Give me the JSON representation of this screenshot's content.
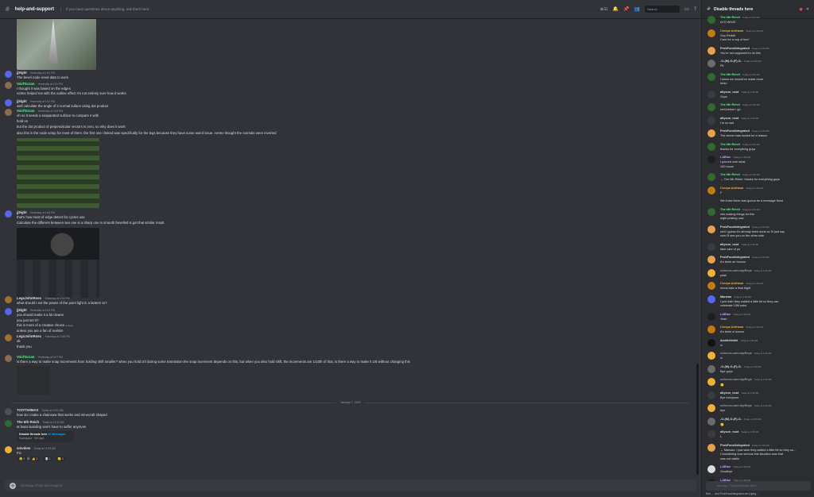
{
  "header": {
    "hash": "#",
    "channel": "help-and-support",
    "topic": "If you have questions about anything, ask them here.",
    "search_placeholder": "Search",
    "thread_count": "31"
  },
  "messages": [
    {
      "user": "jj9ight",
      "time": "Yesterday at 1:51 PM",
      "color": "#dbdee1",
      "av": "#5865f2",
      "lines": [
        "The bevel node need data to work"
      ]
    },
    {
      "user": "VoidTarzan",
      "time": "Yesterday at 1:51 PM",
      "color": "#57f287",
      "av": "#8a6d4e",
      "lines": [
        "I thought it was based on the edges"
      ]
    },
    {
      "user": "",
      "time": "",
      "lines": [
        "vortex helped me with the outline effect i'm not entirely sure how it works"
      ]
    },
    {
      "user": "jj9ight",
      "time": "Yesterday at 1:52 PM",
      "color": "#dbdee1",
      "av": "#5865f2",
      "lines": [
        "well calculate the angle of 2 normal suface using dot product"
      ]
    },
    {
      "user": "VoidTarzan",
      "time": "Yesterday at 1:53 PM",
      "color": "#57f287",
      "av": "#8a6d4e",
      "lines": [
        "oh so it needs a seaparated surface to compare it with"
      ]
    },
    {
      "user": "",
      "time": "",
      "lines": [
        "hold on"
      ]
    },
    {
      "user": "",
      "time": "",
      "lines": [
        "but the dot product of perpendicular vectors is zero, so why does it work"
      ]
    },
    {
      "user": "",
      "time": "",
      "lines": [
        "also this is the node setup for most of them. the first one i linked was specifically for the legs because they have some weird issue. vortex thought the normals were inverted"
      ]
    },
    {
      "user": "jj9ight",
      "time": "Yesterday at 1:54 PM",
      "color": "#dbdee1",
      "av": "#5865f2",
      "lines": [
        "that's how most of edge detect for cycles use",
        "Calculate the different between two one is a sharp one is smooth bevelled is get that similar result"
      ]
    },
    {
      "user": "LegoJohnRoes",
      "time": "Yesterday at 2:02 PM",
      "color": "#dbdee1",
      "av": "#a0712d",
      "lines": [
        "what should I set the power of the point light in a lantern to?"
      ]
    },
    {
      "user": "jj9ight",
      "time": "Yesterday at 2:04 PM",
      "color": "#dbdee1",
      "av": "#5865f2",
      "lines": [
        "you should make it a bit clearer",
        "you just set it?",
        "this is more of a creative choice",
        "unless you are a fan of realism"
      ]
    },
    {
      "user": "LegoJohnRoes",
      "time": "Yesterday at 2:05 PM",
      "color": "#dbdee1",
      "av": "#a0712d",
      "lines": [
        "ok",
        "thank you"
      ]
    },
    {
      "user": "VoidTarzan",
      "time": "Yesterday at 3:07 PM",
      "color": "#57f287",
      "av": "#8a6d4e",
      "lines": [
        "is there a way to make snap increments from holding shift smaller? when you hold ctrl during some translation the snap increment depends on this, but when you also hold shift, the increments are 1/10th of that, is there a way to make it 1/8 without changing this"
      ]
    },
    {
      "user": "TOOTSHMAX",
      "time": "Today at 12:31 AM",
      "color": "#dbdee1",
      "av": "#4e5058",
      "lines": [
        "how do i make a chainsaw that works and minecraft shaped"
      ]
    },
    {
      "user": "The 6th Reich",
      "time": "Today at 12:32 AM",
      "color": "#dbdee1",
      "av": "#2f6b2f",
      "lines": [
        "at least standing won't have to suffer anymore"
      ]
    },
    {
      "user": "smvdem",
      "time": "Today at 12:33 AM",
      "color": "#dbdee1",
      "av": "#f0b232",
      "lines": [
        "Fix",
        "All the channels"
      ]
    }
  ],
  "divider_date": "January 7, 2023",
  "edited": "(edited)",
  "thread_embed": {
    "title": "Disable threads here",
    "mention": "10 Messages",
    "preview": "Ryangoyo · 5m ago"
  },
  "reactions": [
    "2",
    "1",
    "1",
    "1"
  ],
  "composer_placeholder": "Message #help-and-support",
  "thread_panel": {
    "title": "Disable threads here",
    "items": [
      {
        "user": "The 6th Reich",
        "time": "Today at 1:00 AM",
        "color": "#57f287",
        "av": "#2f6b2f",
        "lines": [
          "AYO WHAT"
        ]
      },
      {
        "user": "Creeps Ardhana",
        "time": "Today at 1:05 AM",
        "color": "#f0b232",
        "av": "#c27c0e",
        "lines": [
          "Guy Reddit",
          "Care for a cup of tea?"
        ]
      },
      {
        "user": "ProbFocalIntegrated",
        "time": "Today at 1:06 AM",
        "color": "#dbdee1",
        "av": "#e8a04c",
        "lines": [
          "You're not supposed to do this"
        ]
      },
      {
        "user": "-O-(M)-O-(F)-O-",
        "time": "Today at 1:06 AM",
        "color": "#dbdee1",
        "av": "#6b6b6b",
        "lines": [
          "Pit"
        ]
      },
      {
        "user": "The 6th Reich",
        "time": "Today at 1:06 AM",
        "color": "#57f287",
        "av": "#2f6b2f",
        "lines": [
          "I knew we should've made more",
          "Imao"
        ]
      },
      {
        "user": "allyson_noot",
        "time": "Today at 1:06 AM",
        "color": "#dbdee1",
        "av": "#3a3b40",
        "lines": [
          "Guys"
        ]
      },
      {
        "user": "The 6th Reich",
        "time": "Today at 1:06 AM",
        "color": "#57f287",
        "av": "#2f6b2f",
        "lines": [
          "well,before i go"
        ]
      },
      {
        "user": "allyson_noot",
        "time": "Today at 1:06 AM",
        "color": "#dbdee1",
        "av": "#3a3b40",
        "lines": [
          "I'm so sad"
        ]
      },
      {
        "user": "ProbFocalIntegrated",
        "time": "Today at 1:06 AM",
        "color": "#dbdee1",
        "av": "#e8a04c",
        "lines": [
          "The server was locked for a reason"
        ]
      },
      {
        "user": "The 6th Reich",
        "time": "Today at 1:06 AM",
        "color": "#57f287",
        "av": "#2f6b2f",
        "lines": [
          "thanks for everything guys"
        ]
      },
      {
        "user": "LABlue",
        "time": "Today at 1:06 AM",
        "color": "#c9a0ff",
        "av": "#1e1f22",
        "lines": [
          "I poured over what",
          "100 hours"
        ]
      },
      {
        "user": "The 6th Reich",
        "time": "Today at 1:06 AM",
        "color": "#57f287",
        "av": "#2f6b2f",
        "lines": [
          "→ The 6th Reich: thanks for everything guys"
        ]
      },
      {
        "user": "Creeps Ardhana",
        "time": "Today at 1:06 AM",
        "color": "#f0b232",
        "av": "#c27c0e",
        "lines": [
          "F"
        ]
      },
      {
        "user": "",
        "time": "",
        "lines": [
          "We knew there was gonna be a message flood"
        ]
      },
      {
        "user": "The 6th Reich",
        "time": "Today at 1:06 AM",
        "color": "#57f287",
        "av": "#2f6b2f",
        "lines": [
          "into making things for this",
          "eight posting now"
        ]
      },
      {
        "user": "ProbFocalIntegrated",
        "time": "Today at 1:06 AM",
        "color": "#dbdee1",
        "av": "#e8a04c",
        "lines": [
          "well i guess it's already been done so i'll just say",
          "now i'll see you on the other side"
        ]
      },
      {
        "user": "allyson_noot",
        "time": "Today at 1:06 AM",
        "color": "#dbdee1",
        "av": "#3a3b40",
        "lines": [
          "take care of ya"
        ]
      },
      {
        "user": "ProbFocalIntegrated",
        "time": "Today at 1:06 AM",
        "color": "#dbdee1",
        "av": "#e8a04c",
        "lines": [
          "It's been an honour"
        ]
      },
      {
        "user": "oohcrus.sam.topReya",
        "time": "Today at 1:06 AM",
        "color": "#949ba4",
        "av": "#f0b232",
        "lines": [
          "yeah"
        ]
      },
      {
        "user": "Creeps Ardhana",
        "time": "Today at 1:06 AM",
        "color": "#f0b232",
        "av": "#c27c0e",
        "lines": [
          "Imma take a final flight"
        ]
      },
      {
        "user": "Marwan",
        "time": "Today at 1:06 AM",
        "color": "#dbdee1",
        "av": "#5865f2",
        "lines": [
          "I just wish they waited a little bit so they can",
          "celebrate 10M subs"
        ]
      },
      {
        "user": "LABlue",
        "time": "Today at 1:06 AM",
        "color": "#c9a0ff",
        "av": "#1e1f22",
        "lines": [
          "Yeah"
        ]
      },
      {
        "user": "Creeps Ardhana",
        "time": "Today at 1:06 AM",
        "color": "#f0b232",
        "av": "#c27c0e",
        "lines": [
          "It's been a honour"
        ]
      },
      {
        "user": "doublelinkhi",
        "time": "Today at 1:06 AM",
        "color": "#dbdee1",
        "av": "#111214",
        "lines": [
          "o/"
        ]
      },
      {
        "user": "oohcrus.sam.topReya",
        "time": "Today at 1:06 AM",
        "color": "#949ba4",
        "av": "#f0b232",
        "lines": [
          "o/"
        ]
      },
      {
        "user": "-O-(M)-O-(F)-O-",
        "time": "Today at 1:06 AM",
        "color": "#dbdee1",
        "av": "#6b6b6b",
        "lines": [
          "Bye guys"
        ]
      },
      {
        "user": "oohcrus.sam.topReya",
        "time": "Today at 1:06 AM",
        "color": "#949ba4",
        "av": "#f0b232",
        "lines": [
          "🙂"
        ]
      },
      {
        "user": "allyson_noot",
        "time": "Today at 1:06 AM",
        "color": "#dbdee1",
        "av": "#3a3b40",
        "lines": [
          "Bye everyone"
        ]
      },
      {
        "user": "oohcrus.sam.topReya",
        "time": "Today at 1:06 AM",
        "color": "#949ba4",
        "av": "#f0b232",
        "lines": [
          "bye"
        ]
      },
      {
        "user": "-O-(M)-O-(F)-O-",
        "time": "Today at 1:06 AM",
        "color": "#dbdee1",
        "av": "#6b6b6b",
        "lines": [
          "🙂"
        ]
      },
      {
        "user": "allyson_noot",
        "time": "Today at 1:06 AM",
        "color": "#dbdee1",
        "av": "#3a3b40",
        "lines": [
          "L"
        ]
      },
      {
        "user": "ProbFocalIntegrated",
        "time": "Today at 1:06 AM",
        "color": "#dbdee1",
        "av": "#e8a04c",
        "lines": [
          "→ Marwan: I just wish they waited a little bit so they ca...",
          "Considering how serious this situation was that",
          "was not viable"
        ]
      },
      {
        "user": "LABlue",
        "time": "Today at 1:06 AM",
        "color": "#c9a0ff",
        "av": "#dbdee1",
        "lines": [
          "Goodbye"
        ]
      },
      {
        "user": "LABlue",
        "time": "Today at 1:06 AM",
        "color": "#c9a0ff",
        "av": "#1e1f22",
        "lines": [
          "Bye guys"
        ]
      }
    ],
    "composer_placeholder": "Message \"Disable threads here\"",
    "typing": "Bob, ... and ProbFocalIntegrated are typing..."
  }
}
